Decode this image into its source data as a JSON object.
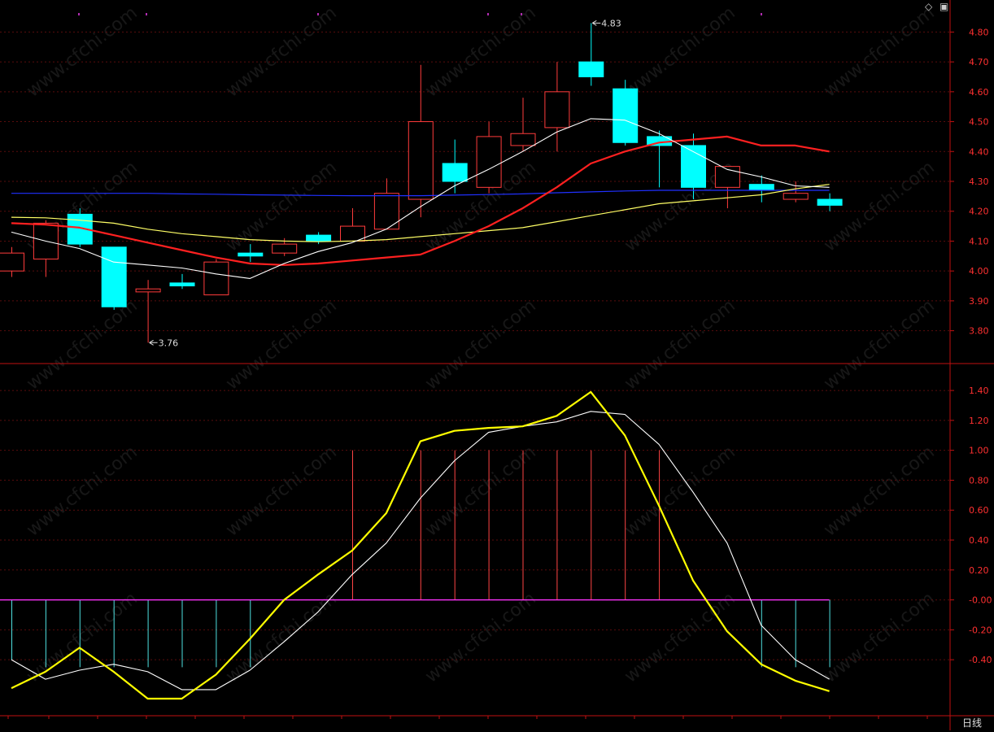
{
  "period_label": "日线",
  "watermark_text": "www.cfchi.com",
  "icons": {
    "settings": "diamond-icon",
    "window": "window-icon"
  },
  "colors": {
    "up": "#ff3b3b",
    "down": "#00ffff",
    "ma_short": "#ffffff",
    "ma_mid": "#ff2020",
    "ma_long": "#ffff66",
    "ma_blue": "#2030ff",
    "axis": "#c01010",
    "grid": "#5a0c0c",
    "kd_fast": "#ffff00",
    "kd_slow": "#ffffff",
    "hist_pos": "#ff4444",
    "hist_neg": "#4ee0e0",
    "hist_spike": "#ff33ff"
  },
  "chart_data": [
    {
      "type": "candlestick",
      "title": "",
      "ylim": [
        3.72,
        4.88
      ],
      "yticks": [
        "4.80",
        "4.70",
        "4.60",
        "4.50",
        "4.40",
        "4.30",
        "4.20",
        "4.10",
        "4.00",
        "3.90",
        "3.80"
      ],
      "annotations": [
        {
          "text": "4.83",
          "index": 17,
          "value": 4.83
        },
        {
          "text": "3.76",
          "index": 4,
          "value": 3.76
        }
      ],
      "candles": [
        {
          "o": 4.0,
          "h": 4.08,
          "l": 3.98,
          "c": 4.06
        },
        {
          "o": 4.04,
          "h": 4.17,
          "l": 3.98,
          "c": 4.16
        },
        {
          "o": 4.19,
          "h": 4.21,
          "l": 4.08,
          "c": 4.09
        },
        {
          "o": 4.08,
          "h": 4.08,
          "l": 3.87,
          "c": 3.88
        },
        {
          "o": 3.93,
          "h": 3.97,
          "l": 3.76,
          "c": 3.94
        },
        {
          "o": 3.96,
          "h": 3.99,
          "l": 3.94,
          "c": 3.95
        },
        {
          "o": 3.92,
          "h": 4.04,
          "l": 3.92,
          "c": 4.03
        },
        {
          "o": 4.06,
          "h": 4.09,
          "l": 4.03,
          "c": 4.05
        },
        {
          "o": 4.06,
          "h": 4.11,
          "l": 4.05,
          "c": 4.09
        },
        {
          "o": 4.12,
          "h": 4.13,
          "l": 4.09,
          "c": 4.1
        },
        {
          "o": 4.1,
          "h": 4.21,
          "l": 4.1,
          "c": 4.15
        },
        {
          "o": 4.14,
          "h": 4.31,
          "l": 4.14,
          "c": 4.26
        },
        {
          "o": 4.24,
          "h": 4.69,
          "l": 4.18,
          "c": 4.5
        },
        {
          "o": 4.36,
          "h": 4.44,
          "l": 4.26,
          "c": 4.3
        },
        {
          "o": 4.28,
          "h": 4.5,
          "l": 4.26,
          "c": 4.45
        },
        {
          "o": 4.42,
          "h": 4.58,
          "l": 4.4,
          "c": 4.46
        },
        {
          "o": 4.48,
          "h": 4.7,
          "l": 4.4,
          "c": 4.6
        },
        {
          "o": 4.7,
          "h": 4.83,
          "l": 4.62,
          "c": 4.65
        },
        {
          "o": 4.61,
          "h": 4.64,
          "l": 4.42,
          "c": 4.43
        },
        {
          "o": 4.45,
          "h": 4.47,
          "l": 4.28,
          "c": 4.42
        },
        {
          "o": 4.42,
          "h": 4.46,
          "l": 4.24,
          "c": 4.28
        },
        {
          "o": 4.28,
          "h": 4.35,
          "l": 4.21,
          "c": 4.35
        },
        {
          "o": 4.29,
          "h": 4.32,
          "l": 4.23,
          "c": 4.27
        },
        {
          "o": 4.24,
          "h": 4.3,
          "l": 4.23,
          "c": 4.26
        },
        {
          "o": 4.24,
          "h": 4.26,
          "l": 4.2,
          "c": 4.22
        }
      ],
      "series": [
        {
          "key": "ma_blue",
          "values": [
            4.26,
            4.26,
            4.26,
            4.26,
            4.26,
            4.258,
            4.257,
            4.255,
            4.254,
            4.253,
            4.252,
            4.252,
            4.252,
            4.254,
            4.256,
            4.258,
            4.262,
            4.265,
            4.268,
            4.27,
            4.27,
            4.27,
            4.27,
            4.27,
            4.27
          ],
          "width": 1.2
        },
        {
          "key": "ma_long",
          "values": [
            4.18,
            4.178,
            4.17,
            4.16,
            4.14,
            4.125,
            4.115,
            4.105,
            4.1,
            4.098,
            4.1,
            4.105,
            4.115,
            4.125,
            4.135,
            4.145,
            4.165,
            4.185,
            4.205,
            4.225,
            4.235,
            4.245,
            4.255,
            4.275,
            4.29
          ],
          "width": 1.2
        },
        {
          "key": "ma_mid",
          "values": [
            4.16,
            4.155,
            4.145,
            4.12,
            4.095,
            4.07,
            4.045,
            4.025,
            4.02,
            4.025,
            4.035,
            4.045,
            4.055,
            4.1,
            4.15,
            4.21,
            4.28,
            4.36,
            4.4,
            4.43,
            4.44,
            4.45,
            4.42,
            4.42,
            4.4
          ],
          "width": 2.2
        },
        {
          "key": "ma_short",
          "values": [
            4.13,
            4.1,
            4.075,
            4.03,
            4.02,
            4.01,
            3.99,
            3.975,
            4.025,
            4.065,
            4.095,
            4.14,
            4.215,
            4.285,
            4.34,
            4.4,
            4.465,
            4.51,
            4.505,
            4.46,
            4.4,
            4.34,
            4.315,
            4.285,
            4.28
          ],
          "width": 1.1
        }
      ]
    },
    {
      "type": "line",
      "title": "",
      "ylim": [
        -0.72,
        1.52
      ],
      "yticks": [
        "1.40",
        "1.20",
        "1.00",
        "0.80",
        "0.60",
        "0.40",
        "0.20",
        "-0.00",
        "-0.20",
        "-0.40"
      ],
      "histogram": [
        -0.4,
        -0.45,
        -0.45,
        -0.45,
        -0.45,
        -0.45,
        -0.45,
        -0.45,
        0,
        0,
        1.0,
        0,
        1.0,
        1.0,
        1.0,
        1.0,
        1.0,
        1.0,
        1.0,
        1.0,
        0,
        0,
        -0.45,
        -0.45,
        -0.45
      ],
      "series": [
        {
          "key": "kd_slow",
          "values": [
            -0.4,
            -0.53,
            -0.47,
            -0.43,
            -0.48,
            -0.6,
            -0.6,
            -0.47,
            -0.28,
            -0.08,
            0.17,
            0.38,
            0.68,
            0.93,
            1.12,
            1.16,
            1.19,
            1.26,
            1.24,
            1.04,
            0.72,
            0.38,
            -0.17,
            -0.4,
            -0.53
          ],
          "width": 1.1
        },
        {
          "key": "kd_fast",
          "values": [
            -0.59,
            -0.48,
            -0.32,
            -0.48,
            -0.66,
            -0.66,
            -0.5,
            -0.26,
            -0.0,
            0.17,
            0.33,
            0.58,
            1.06,
            1.13,
            1.15,
            1.16,
            1.23,
            1.39,
            1.1,
            0.63,
            0.13,
            -0.21,
            -0.43,
            -0.54,
            -0.61
          ],
          "width": 2.2
        }
      ]
    }
  ]
}
